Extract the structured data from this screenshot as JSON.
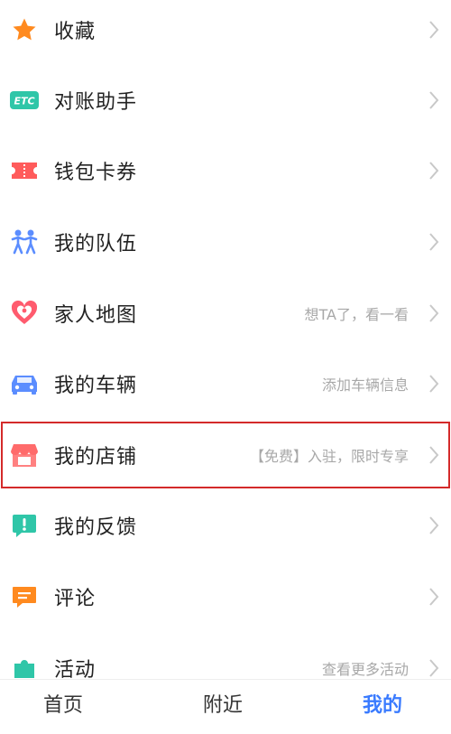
{
  "menu": [
    {
      "label": "收藏",
      "sub": "",
      "icon": "star-icon"
    },
    {
      "label": "对账助手",
      "sub": "",
      "icon": "etc-icon",
      "icon_text": "ETC"
    },
    {
      "label": "钱包卡券",
      "sub": "",
      "icon": "ticket-icon"
    },
    {
      "label": "我的队伍",
      "sub": "",
      "icon": "team-icon"
    },
    {
      "label": "家人地图",
      "sub": "想TA了，看一看",
      "icon": "heart-location-icon"
    },
    {
      "label": "我的车辆",
      "sub": "添加车辆信息",
      "icon": "car-icon"
    },
    {
      "label": "我的店铺",
      "sub": "【免费】入驻，限时专享",
      "icon": "shop-icon"
    },
    {
      "label": "我的反馈",
      "sub": "",
      "icon": "feedback-icon"
    },
    {
      "label": "评论",
      "sub": "",
      "icon": "comment-icon"
    },
    {
      "label": "活动",
      "sub": "查看更多活动",
      "icon": "puzzle-icon"
    }
  ],
  "tabs": [
    {
      "label": "首页",
      "active": false
    },
    {
      "label": "附近",
      "active": false
    },
    {
      "label": "我的",
      "active": true
    }
  ],
  "colors": {
    "accent": "#3a7bff",
    "highlight_border": "#d42a2a",
    "star": "#ff8a1f",
    "etc": "#2fc6a8",
    "ticket": "#ff5b5b",
    "team": "#5b8dff",
    "heart": "#ff5b6e",
    "car": "#5b8dff",
    "shop": "#ff6b6b",
    "feedback": "#2fc6a8",
    "comment": "#ff8a1f",
    "puzzle": "#2fc6a8"
  }
}
